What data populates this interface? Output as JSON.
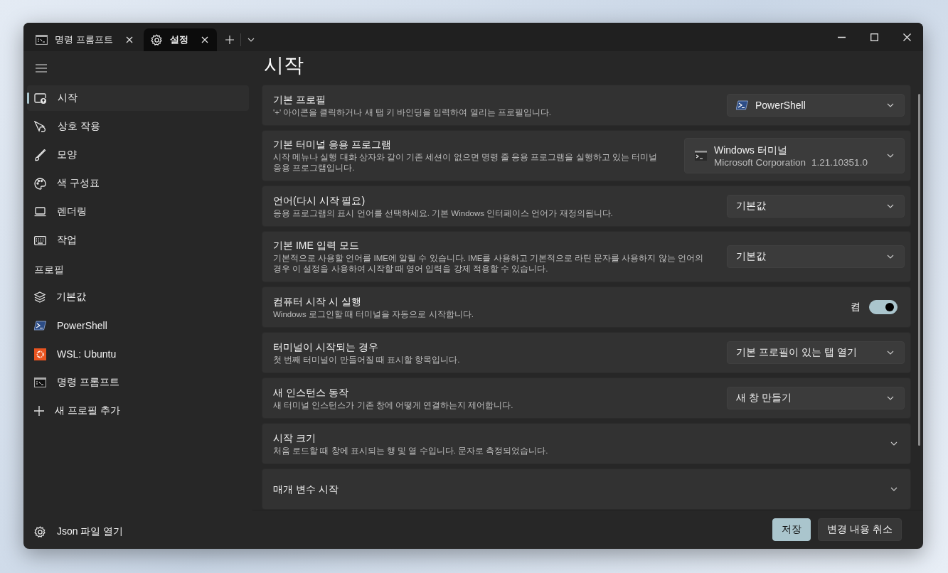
{
  "tabs": [
    {
      "label": "명령 프롬프트",
      "selected": false
    },
    {
      "label": "설정",
      "selected": true
    }
  ],
  "sidebar": {
    "nav_items": [
      {
        "label": "시작",
        "selected": true
      },
      {
        "label": "상호 작용",
        "selected": false
      },
      {
        "label": "모양",
        "selected": false
      },
      {
        "label": "색 구성표",
        "selected": false
      },
      {
        "label": "렌더링",
        "selected": false
      },
      {
        "label": "작업",
        "selected": false
      }
    ],
    "section_header": "프로필",
    "profile_items": [
      {
        "label": "기본값",
        "selected": false
      },
      {
        "label": "PowerShell",
        "selected": false
      },
      {
        "label": "WSL: Ubuntu",
        "selected": false
      },
      {
        "label": "명령 프롬프트",
        "selected": false
      }
    ],
    "add_profile": "새 프로필 추가",
    "open_json": "Json 파일 열기"
  },
  "page_title": "시작",
  "settings": [
    {
      "kind": "profile_dropdown",
      "title": "기본 프로필",
      "description": "'+' 아이콘을 클릭하거나 새 탭 키 바인딩을 입력하여 열리는 프로필입니다.",
      "value": "PowerShell"
    },
    {
      "kind": "app_dropdown",
      "title": "기본 터미널 응용 프로그램",
      "description": "시작 메뉴나 실행 대화 상자와 같이 기존 세션이 없으면 명령 줄 응용 프로그램을 실행하고 있는 터미널 응용 프로그램입니다.",
      "value": "Windows 터미널",
      "publisher": "Microsoft Corporation",
      "version": "1.21.10351.0"
    },
    {
      "kind": "dropdown",
      "title": "언어(다시 시작 필요)",
      "description": "응용 프로그램의 표시 언어를 선택하세요. 기본 Windows 인터페이스 언어가 재정의됩니다.",
      "value": "기본값"
    },
    {
      "kind": "dropdown",
      "title": "기본 IME 입력 모드",
      "description": "기본적으로 사용할 언어를 IME에 알릴 수 있습니다. IME를 사용하고 기본적으로 라틴 문자를 사용하지 않는 언어의 경우 이 설정을 사용하여 시작할 때 영어 입력을 강제 적용할 수 있습니다.",
      "value": "기본값"
    },
    {
      "kind": "toggle",
      "title": "컴퓨터 시작 시 실행",
      "description": "Windows 로그인할 때 터미널을 자동으로 시작합니다.",
      "on": true,
      "state_label": "켬"
    },
    {
      "kind": "dropdown",
      "title": "터미널이 시작되는 경우",
      "description": "첫 번째 터미널이 만들어질 때 표시할 항목입니다.",
      "value": "기본 프로필이 있는 탭 열기"
    },
    {
      "kind": "dropdown",
      "title": "새 인스턴스 동작",
      "description": "새 터미널 인스턴스가 기존 창에 어떻게 연결하는지 제어합니다.",
      "value": "새 창 만들기"
    },
    {
      "kind": "expander",
      "title": "시작 크기",
      "description": "처음 로드할 때 창에 표시되는 행 및 열 수입니다. 문자로 측정되었습니다."
    },
    {
      "kind": "expander",
      "title": "매개 변수 시작"
    }
  ],
  "footer_buttons": [
    {
      "label": "저장",
      "kind": "primary"
    },
    {
      "label": "변경 내용 취소",
      "kind": "secondary"
    }
  ]
}
